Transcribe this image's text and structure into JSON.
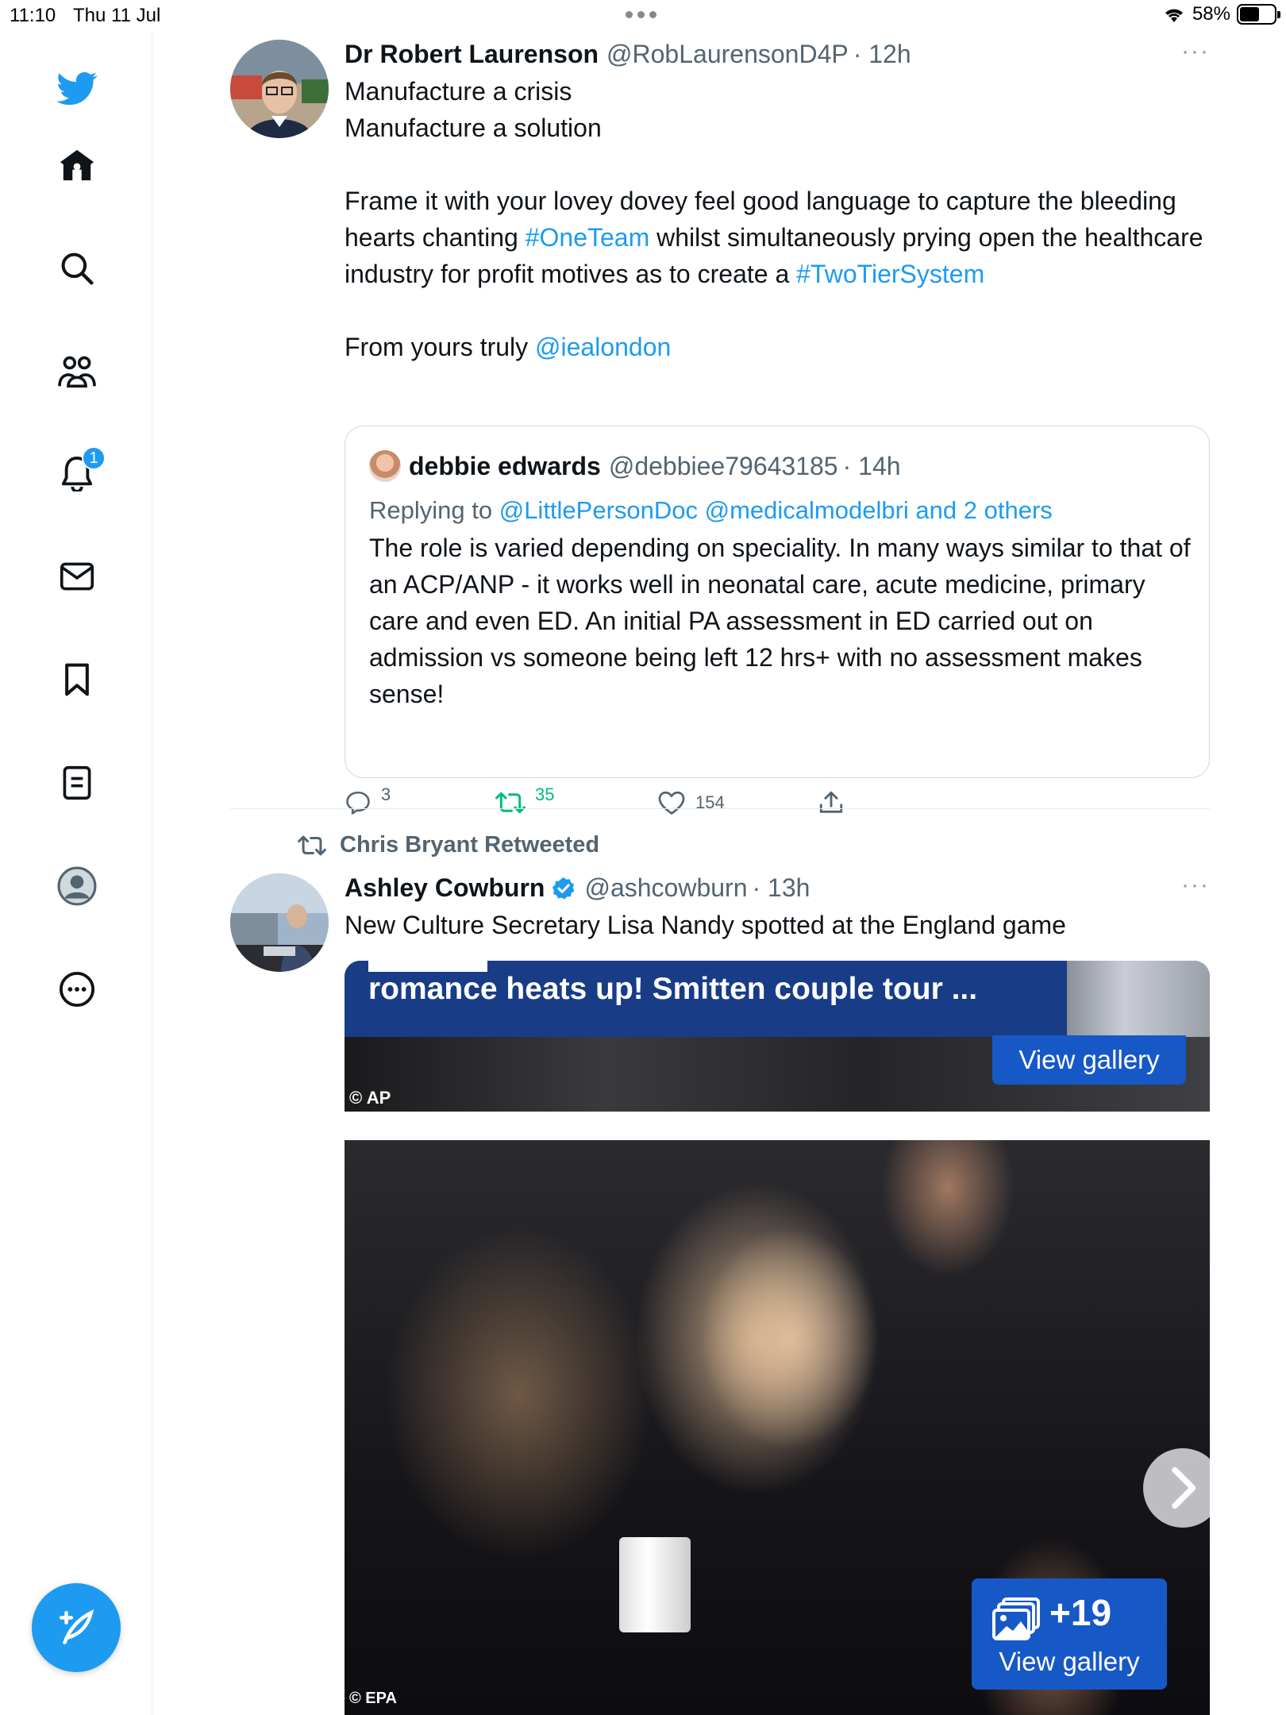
{
  "status_bar": {
    "time": "11:10",
    "date": "Thu 11 Jul",
    "battery": "58%",
    "battery_level": 0.58
  },
  "sidebar": {
    "items": [
      {
        "icon": "twitter-bird-icon"
      },
      {
        "icon": "home-icon"
      },
      {
        "icon": "search-icon"
      },
      {
        "icon": "communities-icon"
      },
      {
        "icon": "notifications-icon",
        "badge": "1"
      },
      {
        "icon": "messages-icon"
      },
      {
        "icon": "bookmarks-icon"
      },
      {
        "icon": "lists-icon"
      },
      {
        "icon": "profile-icon"
      },
      {
        "icon": "more-options-icon"
      }
    ],
    "compose_icon": "compose-tweet-icon"
  },
  "tweet1": {
    "name": "Dr Robert Laurenson",
    "handle": "@RobLaurensonD4P",
    "time": "· 12h",
    "more": "···",
    "lines": [
      "Manufacture a crisis",
      "Manufacture a solution"
    ],
    "para2_a": "Frame it with your lovey dovey feel good language to capture the bleeding hearts chanting ",
    "hashtag1": "#OneTeam",
    "para2_b": " whilst simultaneously prying open the healthcare industry for profit motives as to create a ",
    "hashtag2": "#TwoTierSystem",
    "para3_a": "From yours truly ",
    "mention": "@iealondon",
    "quote": {
      "name": "debbie edwards",
      "handle": "@debbiee79643185",
      "time": "· 14h",
      "replying_prefix": "Replying to ",
      "replying_to": "@LittlePersonDoc @medicalmodelbri and 2 others",
      "text": "The role is varied depending on speciality. In many ways similar to that of an ACP/ANP - it works well in neonatal care, acute medicine, primary care and even ED. An initial PA assessment in ED carried out on admission vs someone being left 12 hrs+ with no assessment makes sense!"
    },
    "actions": {
      "replies": "3",
      "retweets": "35",
      "likes": "154"
    }
  },
  "tweet2": {
    "retweeted_by": "Chris Bryant Retweeted",
    "name": "Ashley Cowburn",
    "handle": "@ashcowburn",
    "time": "· 13h",
    "more": "···",
    "text": "New Culture Secretary Lisa Nandy spotted at the England game",
    "media_top": {
      "headline": "romance heats up! Smitten couple tour ...",
      "button": "View gallery",
      "credit": "AP"
    },
    "media_main": {
      "gallery_count": "+19",
      "gallery_label": "View gallery",
      "credit": "EPA"
    }
  },
  "colors": {
    "accent": "#1d9bf0",
    "retweet": "#00ba7c",
    "secondary_text": "#536471",
    "gallery_blue": "#1758c7"
  }
}
